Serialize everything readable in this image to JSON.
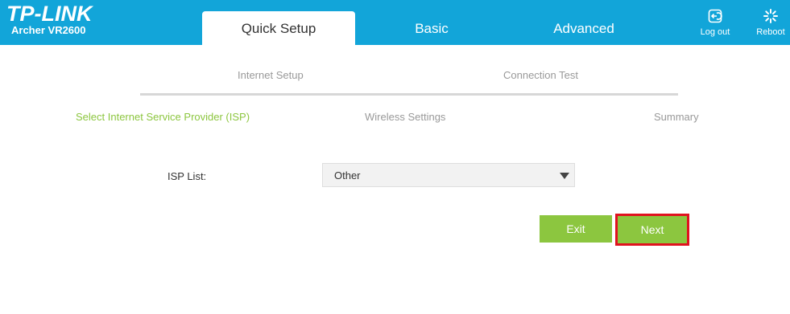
{
  "brand": {
    "logo": "TP-LINK",
    "model": "Archer VR2600"
  },
  "tabs": [
    {
      "label": "Quick Setup",
      "active": true
    },
    {
      "label": "Basic",
      "active": false
    },
    {
      "label": "Advanced",
      "active": false
    }
  ],
  "header_actions": {
    "logout": {
      "label": "Log out",
      "icon": "logout-icon"
    },
    "reboot": {
      "label": "Reboot",
      "icon": "reboot-icon"
    }
  },
  "steps": {
    "top": [
      "Internet Setup",
      "Connection Test"
    ],
    "sub": [
      "Select Internet Service Provider (ISP)",
      "Wireless Settings",
      "Summary"
    ],
    "active_sub": "Select Internet Service Provider (ISP)"
  },
  "form": {
    "isp_label": "ISP List:",
    "isp_value": "Other"
  },
  "buttons": {
    "exit": "Exit",
    "next": "Next"
  },
  "colors": {
    "header_bg": "#12a5d9",
    "accent_green": "#8cc63f",
    "highlight_red": "#e0121f"
  }
}
